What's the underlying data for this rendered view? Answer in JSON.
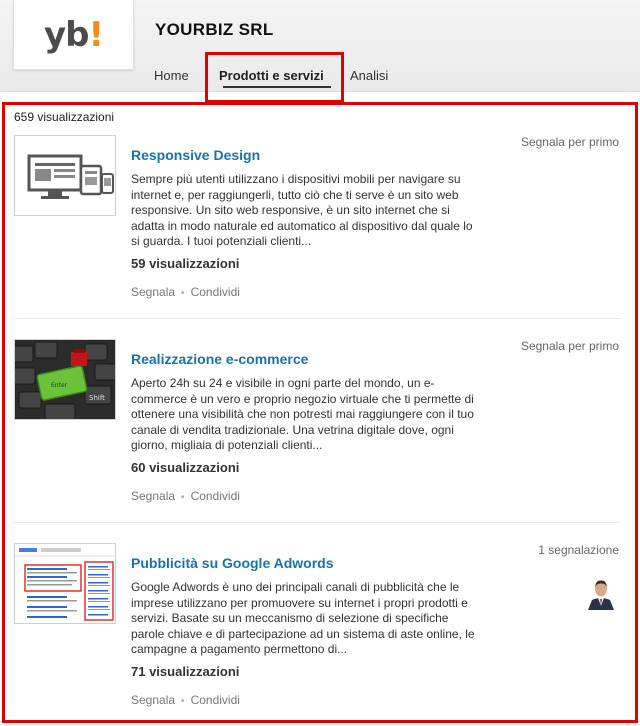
{
  "company": {
    "logo_main": "yb",
    "logo_accent": "!",
    "name": "YOURBIZ SRL"
  },
  "tabs": [
    {
      "label": "Home"
    },
    {
      "label": "Prodotti e servizi",
      "active": true
    },
    {
      "label": "Analisi"
    }
  ],
  "total_views": "659 visualizzazioni",
  "items": [
    {
      "title": "Responsive Design",
      "description": "Sempre più utenti utilizzano i dispositivi mobili per navigare su internet e, per raggiungerli, tutto ciò che ti serve è un sito web responsive. Un sito web responsive, è un sito internet che si adatta in modo naturale ed automatico al dispositivo dal quale lo si guarda. I tuoi potenziali clienti...",
      "views": "59 visualizzazioni",
      "signal": "Segnala per primo",
      "action_report": "Segnala",
      "action_share": "Condividi"
    },
    {
      "title": "Realizzazione e-commerce",
      "description": "Aperto 24h su 24 e visibile in ogni parte del mondo, un e-commerce è un vero e proprio negozio virtuale che ti permette di ottenere una visibilità che non potresti mai raggiungere con il tuo canale di vendita tradizionale. Una vetrina digitale dove, ogni giorno, migliaia di potenziali clienti...",
      "views": "60 visualizzazioni",
      "signal": "Segnala per primo",
      "action_report": "Segnala",
      "action_share": "Condividi"
    },
    {
      "title": "Pubblicità su Google Adwords",
      "description": "Google Adwords è uno dei principali canali di pubblicità che le imprese utilizzano per promuovere su internet i propri prodotti e servizi. Basate su un meccanismo di selezione di specifiche parole chiave e di partecipazione ad un sistema di aste online, le campagne a pagamento permettono di...",
      "views": "71 visualizzazioni",
      "signal": "1 segnalazione",
      "action_report": "Segnala",
      "action_share": "Condividi"
    }
  ],
  "colors": {
    "link": "#1a73a8",
    "highlight": "#e00000",
    "logo_accent": "#f28a1c"
  }
}
